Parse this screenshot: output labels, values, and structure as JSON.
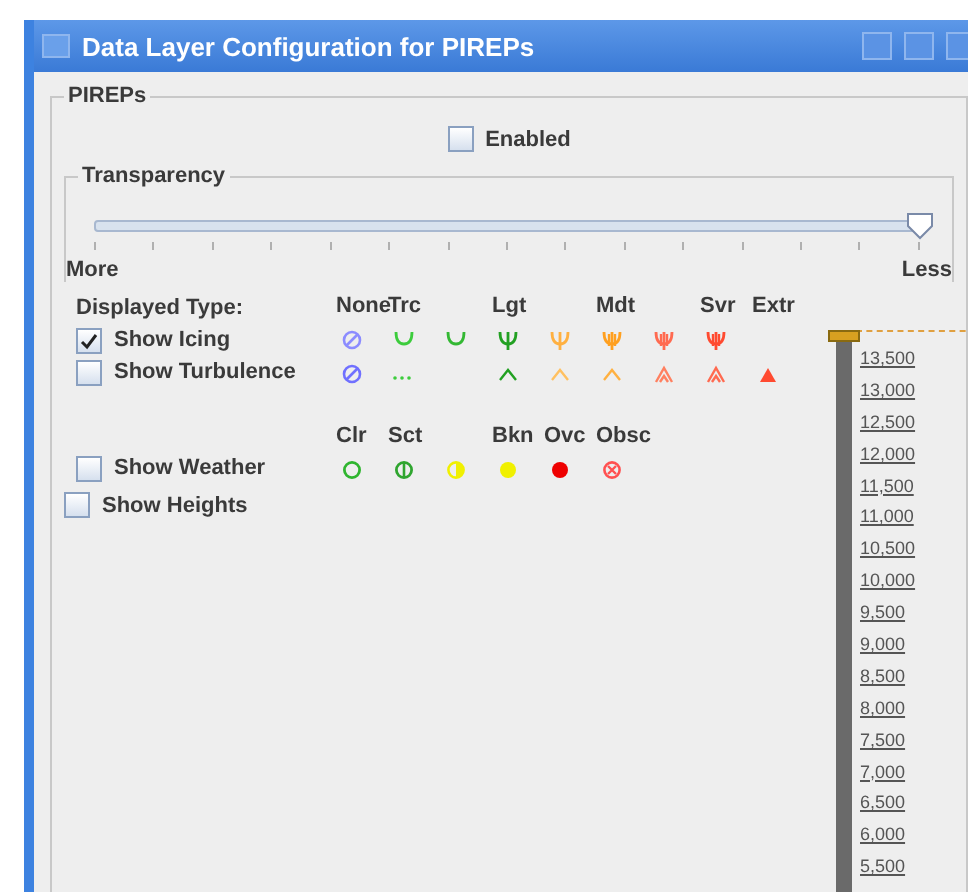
{
  "window": {
    "title": "Data Layer Configuration for PIREPs"
  },
  "group": {
    "title": "PIREPs"
  },
  "enabled": {
    "label": "Enabled",
    "checked": false
  },
  "transparency": {
    "title": "Transparency",
    "level": 1,
    "min_label": "More",
    "max_label": "Less"
  },
  "type_header": {
    "label": "Displayed Type:",
    "columns": [
      "None",
      "Trc",
      "Lgt",
      "Mdt",
      "Svr",
      "Extr"
    ]
  },
  "layers": [
    {
      "kind": "icing",
      "label": "Show Icing",
      "checked": true,
      "symbols": [
        {
          "color": "#8c8cff"
        },
        {
          "color": "#3ccc3c"
        },
        {
          "color": "#33b833"
        },
        {
          "color": "#22a022"
        },
        {
          "color": "#ffb040"
        },
        {
          "color": "#ffa020"
        },
        {
          "color": "#ff6a50"
        },
        {
          "color": "#ff4a30"
        }
      ]
    },
    {
      "kind": "turbulence",
      "label": "Show Turbulence",
      "checked": false,
      "symbols": [
        {
          "color": "#7070ff"
        },
        {
          "color": "#3ccc3c"
        },
        {
          "color": "#22a022"
        },
        {
          "color": "#ffc060"
        },
        {
          "color": "#ffb040"
        },
        {
          "color": "#ff8060"
        },
        {
          "color": "#ff6a50"
        },
        {
          "color": "#ff4a30"
        }
      ]
    }
  ],
  "weather_header": {
    "columns": [
      "Clr",
      "Sct",
      "Bkn",
      "Ovc",
      "Obsc"
    ]
  },
  "weather": {
    "label": "Show Weather",
    "checked": false,
    "symbols": [
      {
        "color": "#2fb52f"
      },
      {
        "color": "#2fa52f"
      },
      {
        "color": "#f0f000"
      },
      {
        "color": "#f0f000"
      },
      {
        "color": "#ee0000"
      },
      {
        "color": "#ff5050"
      }
    ]
  },
  "heights": {
    "label": "Show Heights",
    "checked": false
  },
  "altitude_scale": {
    "level": 1,
    "labels": [
      "13,500",
      "13,000",
      "12,500",
      "12,000",
      "11,500",
      "11,000",
      "10,500",
      "10,000",
      "9,500",
      "9,000",
      "8,500",
      "8,000",
      "7,500",
      "7,000",
      "6,500",
      "6,000",
      "5,500"
    ]
  }
}
